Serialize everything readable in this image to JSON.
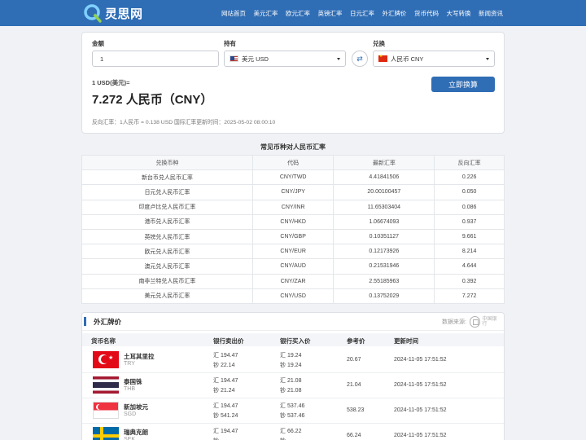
{
  "header": {
    "logo_text": "灵思网",
    "nav": [
      "网站首页",
      "美元汇率",
      "欧元汇率",
      "英镑汇率",
      "日元汇率",
      "外汇牌价",
      "货币代码",
      "大写转换",
      "新闻资讯"
    ]
  },
  "converter": {
    "amount_label": "金额",
    "amount_value": "1",
    "have_label": "持有",
    "have_value": "美元 USD",
    "exchange_label": "兑换",
    "exchange_value": "人民币 CNY",
    "swap_icon": "⇄",
    "convert_button": "立即换算",
    "result_small": "1 USD(美元)=",
    "result_big": "7.272 人民币（CNY）",
    "reverse_note": "反向汇率：1人民币 = 0.138 USD  国际汇率更新时间：2025-05-02 08:00:10"
  },
  "common_table": {
    "title": "常见币种对人民币汇率",
    "headers": [
      "兑换币种",
      "代码",
      "最新汇率",
      "反向汇率"
    ],
    "rows": [
      [
        "新台币兑人民币汇率",
        "CNY/TWD",
        "4.41841506",
        "0.226"
      ],
      [
        "日元兑人民币汇率",
        "CNY/JPY",
        "20.00100457",
        "0.050"
      ],
      [
        "印度卢比兑人民币汇率",
        "CNY/INR",
        "11.65303404",
        "0.086"
      ],
      [
        "港币兑人民币汇率",
        "CNY/HKD",
        "1.06674093",
        "0.937"
      ],
      [
        "英镑兑人民币汇率",
        "CNY/GBP",
        "0.10351127",
        "9.661"
      ],
      [
        "欧元兑人民币汇率",
        "CNY/EUR",
        "0.12173926",
        "8.214"
      ],
      [
        "澳元兑人民币汇率",
        "CNY/AUD",
        "0.21531946",
        "4.644"
      ],
      [
        "南非兰特兑人民币汇率",
        "CNY/ZAR",
        "2.55185963",
        "0.392"
      ],
      [
        "美元兑人民币汇率",
        "CNY/USD",
        "0.13752029",
        "7.272"
      ]
    ]
  },
  "forex": {
    "title": "外汇牌价",
    "source_label": "数据来源:",
    "source_logo_text": "中国银行",
    "headers": [
      "货币名称",
      "银行卖出价",
      "银行买入价",
      "参考价",
      "更新时间"
    ],
    "rows": [
      {
        "name": "土耳其里拉",
        "code": "TRY",
        "flag": "turkey-flag-icon",
        "sell_hui": "汇 194.47",
        "sell_chao": "钞 22.14",
        "buy_hui": "汇 19.24",
        "buy_chao": "钞 19.24",
        "ref": "20.67",
        "time": "2024-11-05 17:51:52"
      },
      {
        "name": "泰国铢",
        "code": "THB",
        "flag": "thailand-flag-icon",
        "sell_hui": "汇 194.47",
        "sell_chao": "钞 21.24",
        "buy_hui": "汇 21.08",
        "buy_chao": "钞 21.08",
        "ref": "21.04",
        "time": "2024-11-05 17:51:52"
      },
      {
        "name": "新加坡元",
        "code": "SGD",
        "flag": "singapore-flag-icon",
        "sell_hui": "汇 194.47",
        "sell_chao": "钞 541.24",
        "buy_hui": "汇 537.46",
        "buy_chao": "钞 537.46",
        "ref": "538.23",
        "time": "2024-11-05 17:51:52"
      },
      {
        "name": "瑞典克朗",
        "code": "SEK",
        "flag": "sweden-flag-icon",
        "sell_hui": "汇 194.47",
        "sell_chao": "钞 ",
        "buy_hui": "汇 66.22",
        "buy_chao": "钞 ",
        "ref": "66.24",
        "time": "2024-11-05 17:51:52"
      }
    ]
  },
  "colors": {
    "brand_blue": "#2f6db5",
    "background": "#f0f2f5"
  }
}
